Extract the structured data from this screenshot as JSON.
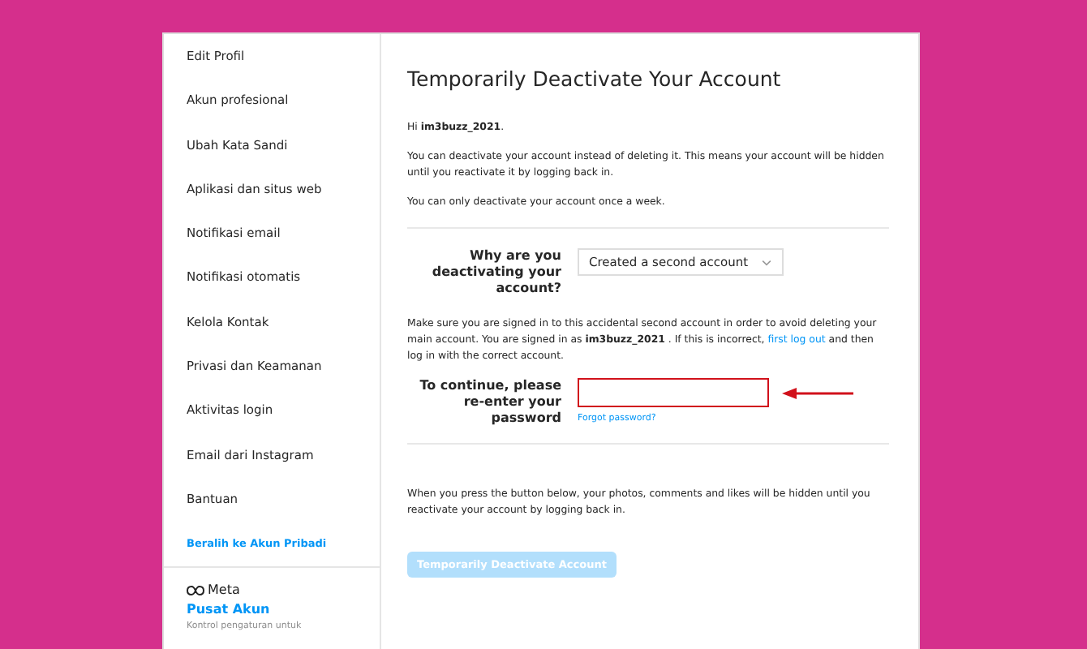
{
  "sidebar": {
    "items": [
      {
        "label": "Edit Profil",
        "kind": "item"
      },
      {
        "label": "Akun profesional",
        "kind": "item"
      },
      {
        "label": "Ubah Kata Sandi",
        "kind": "item"
      },
      {
        "label": "Aplikasi dan situs web",
        "kind": "item"
      },
      {
        "label": "Notifikasi email",
        "kind": "item"
      },
      {
        "label": "Notifikasi otomatis",
        "kind": "item"
      },
      {
        "label": "Kelola Kontak",
        "kind": "item"
      },
      {
        "label": "Privasi dan Keamanan",
        "kind": "item"
      },
      {
        "label": "Aktivitas login",
        "kind": "item"
      },
      {
        "label": "Email dari Instagram",
        "kind": "item"
      },
      {
        "label": "Bantuan",
        "kind": "item"
      },
      {
        "label": "Beralih ke Akun Pribadi",
        "kind": "link"
      }
    ],
    "footer": {
      "brand": "Meta",
      "title": "Pusat Akun",
      "text": "Kontrol pengaturan untuk"
    }
  },
  "main": {
    "title": "Temporarily Deactivate Your Account",
    "greeting": "Hi **im3buzz_2021**.",
    "intro": "You can deactivate your account instead of deleting it. This means your account will be hidden until you reactivate it by logging back in.",
    "limit": "You can only deactivate your account once a week.",
    "reason_label": "Why are you deactivating your account?",
    "reason_value": "Created a second account",
    "notice_before": "Make sure you are signed in to this accidental second account in order to avoid deleting your main account. You are signed in as **im3buzz_2021** . If this is incorrect, ",
    "notice_link": "first log out",
    "notice_after": " and then log in with the correct account.",
    "password_label": "To continue, please re-enter your password",
    "password_highlighted": true,
    "forgot": "Forgot password?",
    "warning": "When you press the button below, your photos, comments and likes will be hidden until you reactivate your account by logging back in.",
    "button": {
      "label": "Temporarily Deactivate Account",
      "disabled": true
    }
  }
}
